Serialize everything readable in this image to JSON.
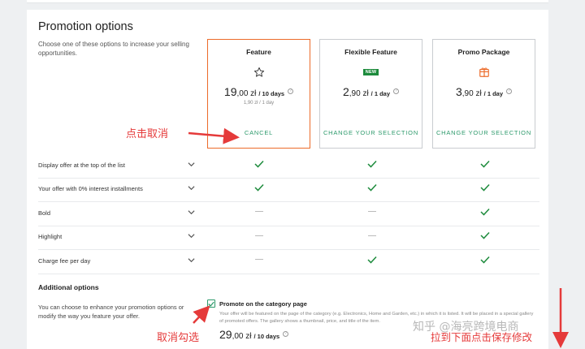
{
  "page": {
    "title": "Promotion options",
    "intro": "Choose one of these options to increase your selling opportunities."
  },
  "cards": [
    {
      "title": "Feature",
      "icon": "star-icon",
      "price_int": "19",
      "price_dec": ",00 zł",
      "period": "/ 10 days",
      "sub": "1,90 zł / 1 day",
      "action": "CANCEL",
      "selected": true
    },
    {
      "title": "Flexible Feature",
      "badge": "NEW",
      "price_int": "2",
      "price_dec": ",90 zł",
      "period": "/ 1 day",
      "action": "CHANGE YOUR SELECTION",
      "selected": false
    },
    {
      "title": "Promo Package",
      "icon": "package-icon",
      "price_int": "3",
      "price_dec": ",90 zł",
      "period": "/ 1 day",
      "action": "CHANGE YOUR SELECTION",
      "selected": false
    }
  ],
  "features": [
    {
      "label": "Display offer at the top of the list",
      "values": [
        "check",
        "check",
        "check"
      ]
    },
    {
      "label": "Your offer with 0% interest installments",
      "values": [
        "check",
        "check",
        "check"
      ]
    },
    {
      "label": "Bold",
      "values": [
        "dash",
        "dash",
        "check"
      ]
    },
    {
      "label": "Highlight",
      "values": [
        "dash",
        "dash",
        "check"
      ]
    },
    {
      "label": "Charge fee per day",
      "values": [
        "dash",
        "check",
        "check"
      ]
    }
  ],
  "additional": {
    "title": "Additional options",
    "text": "You can choose to enhance your promotion options or modify the way you feature your offer.",
    "option_label": "Promote on the category page",
    "option_desc": "Your offer will be featured on the page of the category (e.g. Electronics, Home and Garden, etc.) in which it is listed. It will be placed in a special gallery of promoted offers. The gallery shows a thumbnail, price, and title of the item.",
    "price_int": "29",
    "price_dec": ",00 zł",
    "period": "/ 10 days",
    "checked": true
  },
  "annotations": {
    "cancel_note": "点击取消",
    "uncheck_note": "取消勾选",
    "save_note": "拉到下面点击保存修改"
  },
  "watermark": "知乎 @海亮跨境电商",
  "colors": {
    "accent_orange": "#ec6b2a",
    "accent_green": "#2e9a6c",
    "check_green": "#1d8b3c",
    "annotation_red": "#e53a3a"
  }
}
